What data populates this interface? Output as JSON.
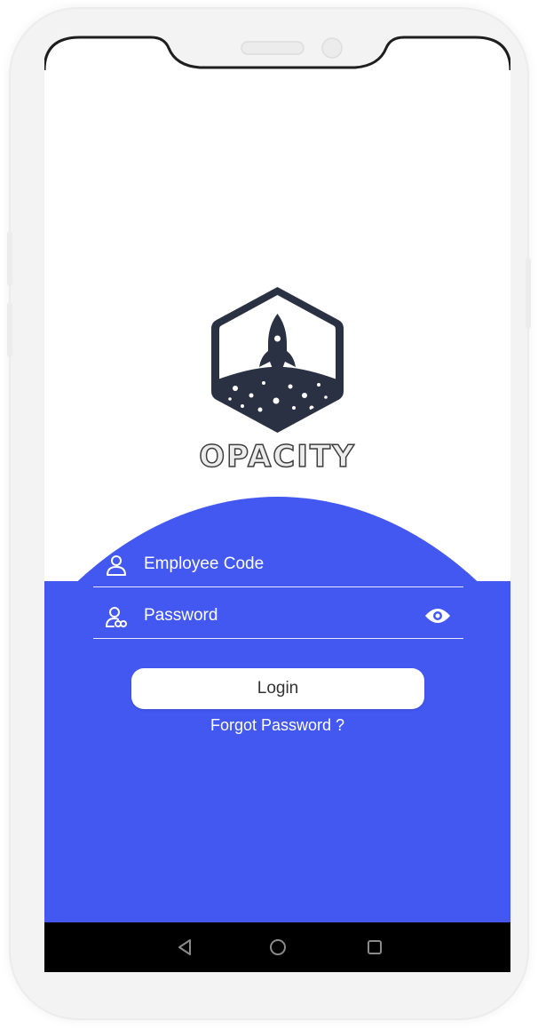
{
  "app": {
    "brand_name": "OPACITY"
  },
  "login_form": {
    "employee_code_placeholder": "Employee Code",
    "password_placeholder": "Password",
    "login_label": "Login",
    "forgot_password_label": "Forgot Password ?"
  },
  "nav_bar": {
    "buttons": [
      "back-icon",
      "home-icon",
      "recents-icon"
    ]
  },
  "colors": {
    "accent": "#4358f0",
    "logo": "#2a3142",
    "nav_bar": "#000000"
  }
}
